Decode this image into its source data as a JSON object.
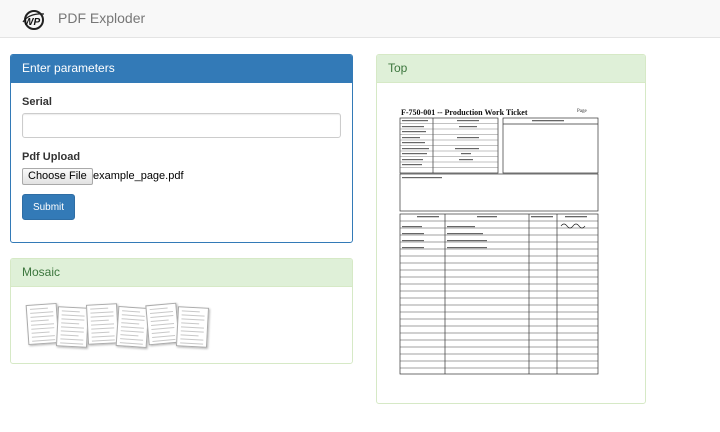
{
  "header": {
    "logo_text": "WP",
    "app_title": "PDF Exploder"
  },
  "params_panel": {
    "title": "Enter parameters",
    "serial_label": "Serial",
    "serial_value": "",
    "upload_label": "Pdf Upload",
    "choose_file_label": "Choose File",
    "file_name": "example_page.pdf",
    "submit_label": "Submit"
  },
  "mosaic_panel": {
    "title": "Mosaic",
    "thumbnail_count": 6
  },
  "top_panel": {
    "title": "Top",
    "document": {
      "title": "F-750-001 -- Production Work Ticket",
      "page_label": "Page"
    }
  }
}
